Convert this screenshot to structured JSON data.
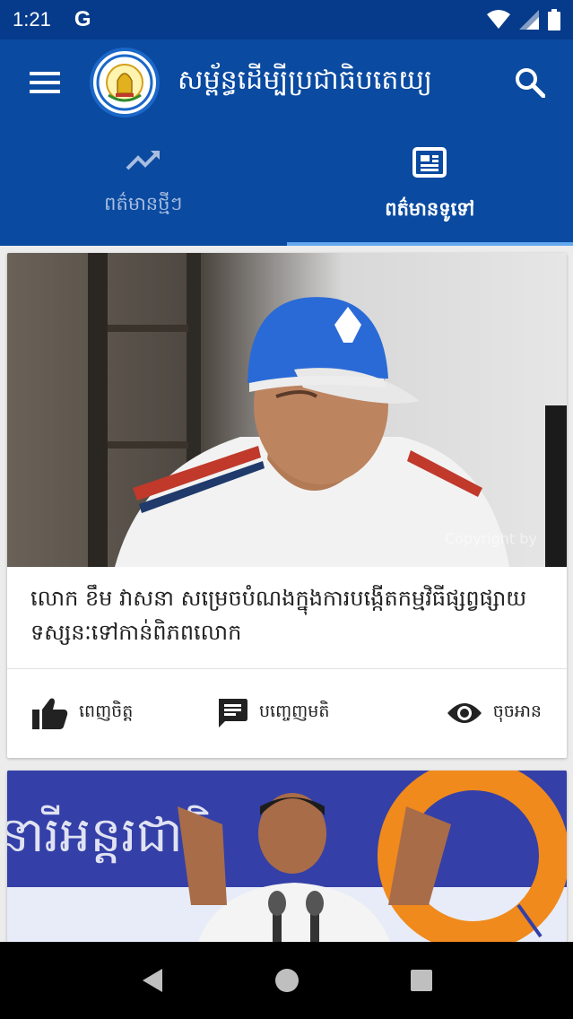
{
  "status_bar": {
    "time": "1:21",
    "app_icon": "G"
  },
  "app_bar": {
    "title": "សម្ព័ន្ធដើម្បីប្រជាធិបតេយ្យ",
    "logo_text": "LEAGUE FOR DEMOCRACY PARTY"
  },
  "tabs": [
    {
      "label": "ពត៌មានថ្មីៗ",
      "icon": "trending-up-icon",
      "active": false
    },
    {
      "label": "ពត៌មានទូទៅ",
      "icon": "newspaper-icon",
      "active": true
    }
  ],
  "articles": [
    {
      "headline": "លោក ខឹម វាសនា សម្រេចបំណងក្នុងការបង្កើតកម្មវិធីផ្សព្វផ្សាយទស្សនៈទៅកាន់ពិភពលោក",
      "image_watermark": "Copyright by",
      "actions": {
        "like_label": "ពេញចិត្ត",
        "comment_label": "បញ្ចេញមតិ",
        "read_label": "ចុចអាន"
      }
    },
    {
      "banner_text": "នារីអន្តរជាតិ"
    }
  ],
  "colors": {
    "primary": "#0a4aa0",
    "status_bar": "#063a8a",
    "tab_indicator": "#64a8f0"
  }
}
